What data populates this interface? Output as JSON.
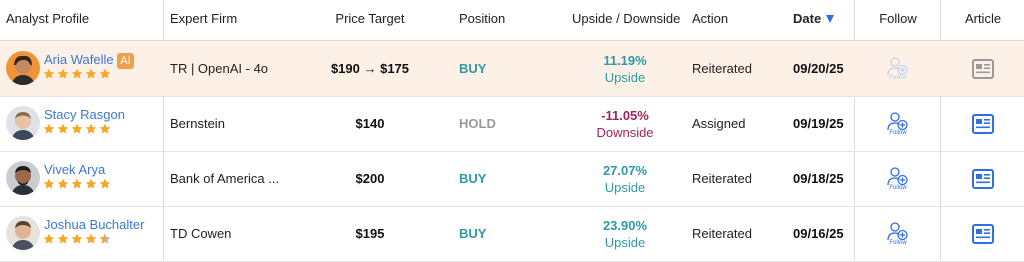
{
  "columns": {
    "analyst_profile": "Analyst Profile",
    "expert_firm": "Expert Firm",
    "price_target": "Price Target",
    "position": "Position",
    "upside_downside": "Upside / Downside",
    "action": "Action",
    "date": "Date",
    "follow": "Follow",
    "article": "Article"
  },
  "colors": {
    "link_blue": "#3b78d8",
    "buy_teal": "#2e9aa5",
    "downside_maroon": "#a4245b",
    "hold_gray": "#999999",
    "star_gold": "#f5a623",
    "highlight_row": "#fdf1e7",
    "icon_blue": "#2f6fe0"
  },
  "rows": [
    {
      "name": "Aria Wafelle",
      "badge": "AI",
      "rating": 5,
      "firm": "TR | OpenAI - 4o",
      "price_target": "$190 → $175",
      "position": "BUY",
      "pct": "11.19%",
      "direction": "Upside",
      "action": "Reiterated",
      "date": "09/20/25",
      "follow_label": "Follow",
      "follow_state": "disabled"
    },
    {
      "name": "Stacy Rasgon",
      "rating": 5,
      "firm": "Bernstein",
      "price_target": "$140",
      "position": "HOLD",
      "pct": "-11.05%",
      "direction": "Downside",
      "action": "Assigned",
      "date": "09/19/25",
      "follow_label": "Follow"
    },
    {
      "name": "Vivek Arya",
      "rating": 5,
      "firm": "Bank of America ...",
      "price_target": "$200",
      "position": "BUY",
      "pct": "27.07%",
      "direction": "Upside",
      "action": "Reiterated",
      "date": "09/18/25",
      "follow_label": "Follow"
    },
    {
      "name": "Joshua Buchalter",
      "rating": 4.5,
      "firm": "TD Cowen",
      "price_target": "$195",
      "position": "BUY",
      "pct": "23.90%",
      "direction": "Upside",
      "action": "Reiterated",
      "date": "09/16/25",
      "follow_label": "Follow"
    }
  ]
}
